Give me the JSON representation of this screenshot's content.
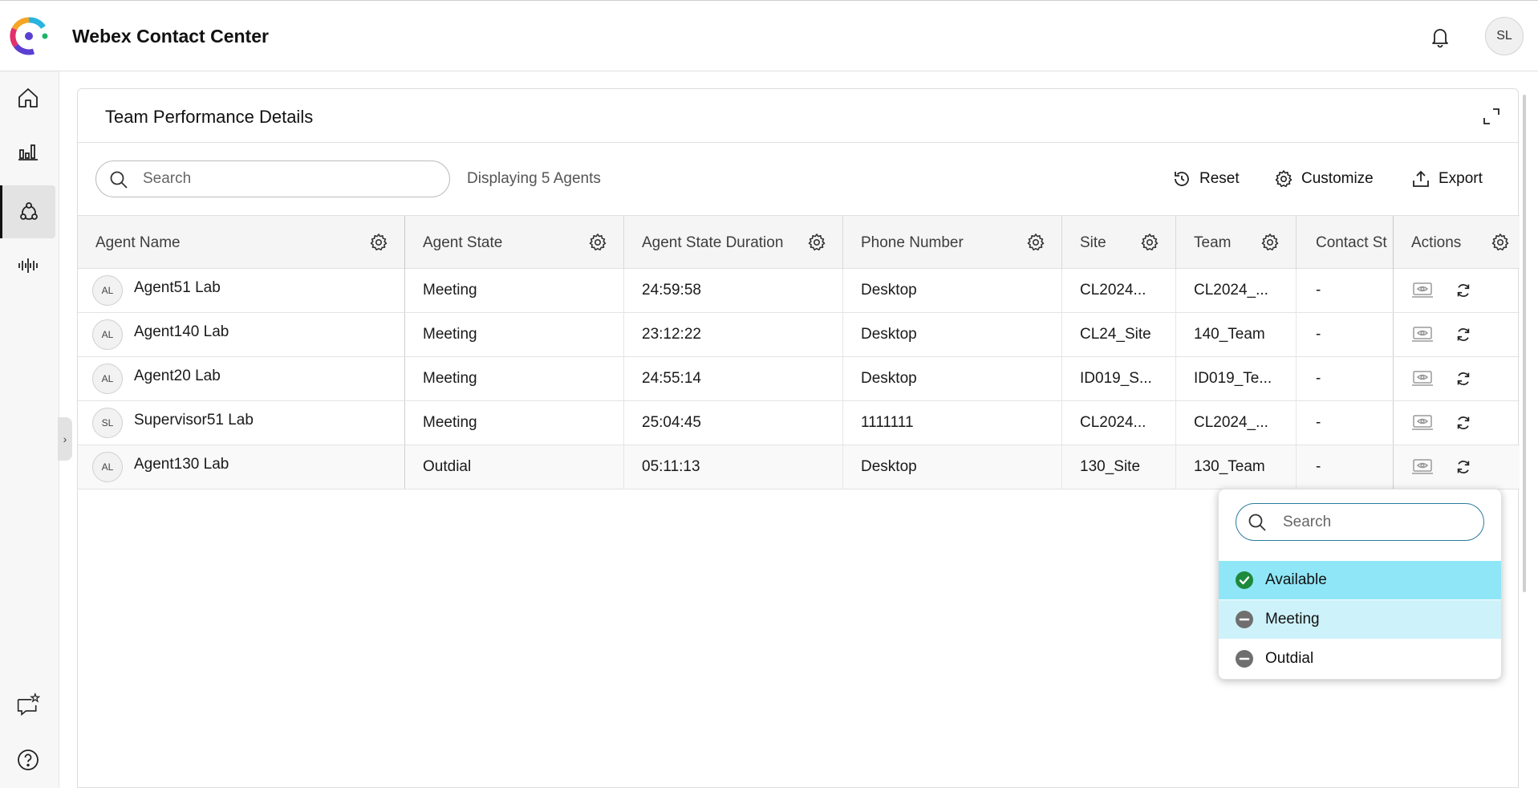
{
  "header": {
    "app_title": "Webex Contact Center",
    "user_initials": "SL",
    "logo_icon": "webex-logo",
    "notification_icon": "bell-icon"
  },
  "sidebar": {
    "items": [
      {
        "name": "home",
        "icon": "home-icon",
        "active": false
      },
      {
        "name": "analytics",
        "icon": "bar-chart-icon",
        "active": false
      },
      {
        "name": "team-performance",
        "icon": "team-icon",
        "active": true
      },
      {
        "name": "recordings",
        "icon": "waveform-icon",
        "active": false
      }
    ],
    "bottom_items": [
      {
        "name": "feedback",
        "icon": "chat-star-icon"
      },
      {
        "name": "help",
        "icon": "help-icon"
      }
    ],
    "collapse_glyph": "›"
  },
  "panel": {
    "title": "Team Performance Details",
    "search_placeholder": "Search",
    "agent_count_text": "Displaying 5 Agents",
    "toolbar": {
      "reset_label": "Reset",
      "customize_label": "Customize",
      "export_label": "Export"
    }
  },
  "table": {
    "columns": [
      "Agent Name",
      "Agent State",
      "Agent State Duration",
      "Phone Number",
      "Site",
      "Team",
      "Contact St",
      "Actions"
    ],
    "rows": [
      {
        "initials": "AL",
        "name": "Agent51 Lab",
        "state": "Meeting",
        "duration": "24:59:58",
        "phone": "Desktop",
        "site": "CL2024...",
        "team": "CL2024_...",
        "contact": "-"
      },
      {
        "initials": "AL",
        "name": "Agent140 Lab",
        "state": "Meeting",
        "duration": "23:12:22",
        "phone": "Desktop",
        "site": "CL24_Site",
        "team": "140_Team",
        "contact": "-"
      },
      {
        "initials": "AL",
        "name": "Agent20 Lab",
        "state": "Meeting",
        "duration": "24:55:14",
        "phone": "Desktop",
        "site": "ID019_S...",
        "team": "ID019_Te...",
        "contact": "-"
      },
      {
        "initials": "SL",
        "name": "Supervisor51 Lab",
        "state": "Meeting",
        "duration": "25:04:45",
        "phone": "1111111",
        "site": "CL2024...",
        "team": "CL2024_...",
        "contact": "-"
      },
      {
        "initials": "AL",
        "name": "Agent130 Lab",
        "state": "Outdial",
        "duration": "05:11:13",
        "phone": "Desktop",
        "site": "130_Site",
        "team": "130_Team",
        "contact": "-"
      }
    ]
  },
  "dropdown": {
    "search_placeholder": "Search",
    "options": [
      {
        "label": "Available",
        "status_color": "#1d8a3c",
        "bg": "#8fe6f7",
        "icon": "check-circle-icon"
      },
      {
        "label": "Meeting",
        "status_color": "#6f6f6f",
        "bg": "#cdf2fa",
        "icon": "minus-circle-icon"
      },
      {
        "label": "Outdial",
        "status_color": "#6f6f6f",
        "bg": "#ffffff",
        "icon": "minus-circle-icon"
      }
    ]
  }
}
